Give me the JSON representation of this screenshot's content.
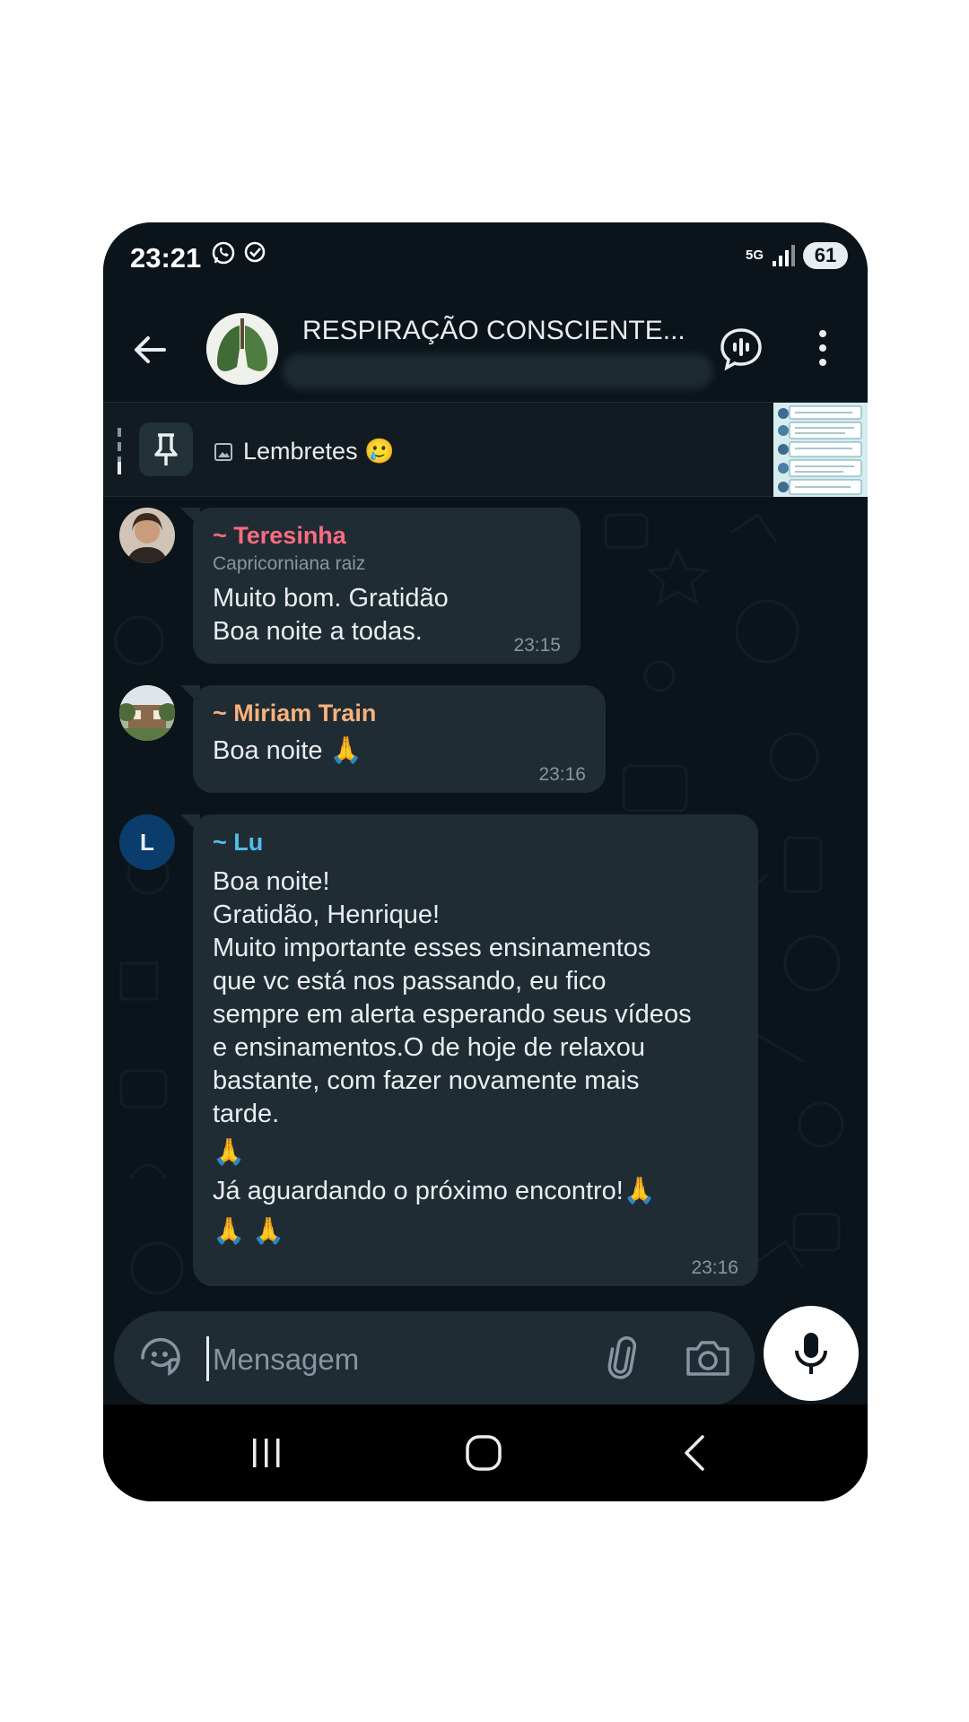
{
  "status_bar": {
    "time": "23:21",
    "network": "5G",
    "battery": "61"
  },
  "header": {
    "title": "RESPIRAÇÃO CONSCIENTE..."
  },
  "pinned": {
    "text": "Lembretes",
    "emoji": "🥲"
  },
  "messages": [
    {
      "sender": "~ Teresinha",
      "sender_color": "#ff6b81",
      "subtitle": "Capricorniana raiz",
      "lines": [
        "Muito bom. Gratidão",
        "Boa noite a todas."
      ],
      "time": "23:15"
    },
    {
      "sender": "~ Miriam Train",
      "sender_color": "#f7b27b",
      "lines": [
        "Boa noite 🙏"
      ],
      "time": "23:16"
    },
    {
      "sender": "~ Lu",
      "sender_color": "#53bdeb",
      "avatar_letter": "L",
      "lines": [
        "Boa noite!",
        "Gratidão, Henrique!",
        "Muito importante esses ensinamentos",
        "que vc está nos passando, eu fico",
        "sempre em alerta esperando seus vídeos",
        "e ensinamentos.O de hoje de relaxou",
        "bastante, com fazer novamente mais",
        "tarde.",
        "🙏",
        "Já aguardando o próximo encontro!🙏",
        "🙏 🙏"
      ],
      "time": "23:16"
    }
  ],
  "input": {
    "placeholder": "Mensagem"
  },
  "colors": {
    "background": "#0b141a",
    "bubble": "#202c33",
    "input": "#1f2c33",
    "accent_mic": "#ffffff"
  }
}
